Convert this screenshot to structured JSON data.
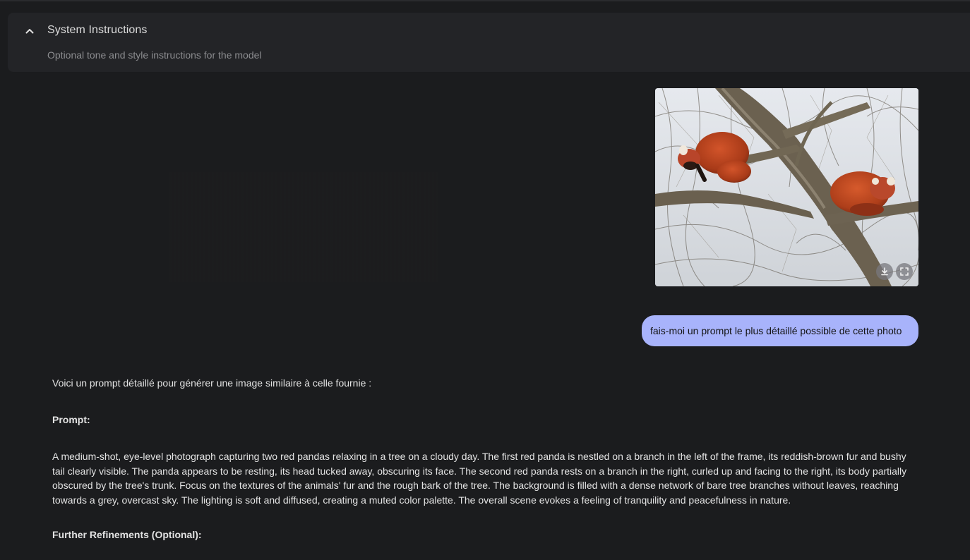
{
  "system_instructions": {
    "title": "System Instructions",
    "subtitle": "Optional tone and style instructions for the model",
    "toggle_icon": "chevron-up-icon"
  },
  "attachment": {
    "alt": "Two red pandas resting on branches of a bare tree against an overcast sky",
    "actions": [
      {
        "name": "download",
        "icon": "download-icon"
      },
      {
        "name": "fullscreen",
        "icon": "fullscreen-icon"
      }
    ]
  },
  "user_message": {
    "text": "fais-moi un prompt le plus détaillé possible de cette photo"
  },
  "model_response": {
    "intro": "Voici un prompt détaillé pour générer une image similaire à celle fournie :",
    "heading_prompt": "Prompt:",
    "prompt_body": "A medium-shot, eye-level photograph capturing two red pandas relaxing in a tree on a cloudy day. The first red panda is nestled on a branch in the left of the frame, its reddish-brown fur and bushy tail clearly visible. The panda appears to be resting, its head tucked away, obscuring its face. The second red panda rests on a branch in the right, curled up and facing to the right, its body partially obscured by the tree's trunk. Focus on the textures of the animals' fur and the rough bark of the tree. The background is filled with a dense network of bare tree branches without leaves, reaching towards a grey, overcast sky. The lighting is soft and diffused, creating a muted color palette. The overall scene evokes a feeling of tranquility and peacefulness in nature.",
    "heading_refinements": "Further Refinements (Optional):"
  },
  "colors": {
    "background": "#1b1c1e",
    "panel": "#232427",
    "user_bubble": "#a8b3fb",
    "text": "#e3e3e3",
    "muted_text": "#8c8d90"
  }
}
